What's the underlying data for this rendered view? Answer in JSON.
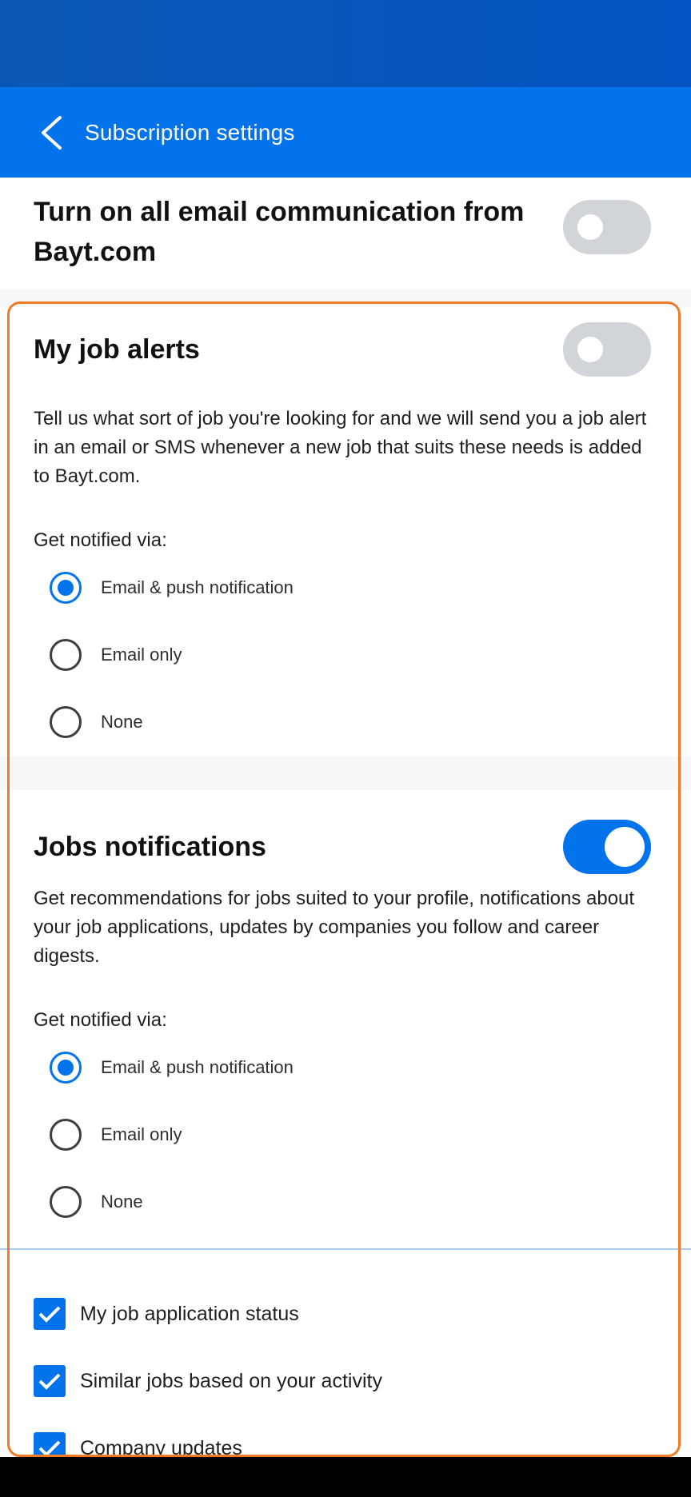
{
  "header": {
    "title": "Subscription settings"
  },
  "master": {
    "label": "Turn on all email communication from Bayt.com",
    "enabled": false
  },
  "job_alerts": {
    "title": "My job alerts",
    "enabled": false,
    "description": "Tell us what sort of job you're looking for and we will send you a job alert in an email or SMS whenever a new job that suits these needs is added to Bayt.com.",
    "notify_label": "Get notified via:",
    "options": [
      "Email & push notification",
      "Email only",
      "None"
    ],
    "selected": "Email & push notification"
  },
  "jobs_notifications": {
    "title": "Jobs notifications",
    "enabled": true,
    "description": "Get recommendations for jobs suited to your profile, notifications about your job applications, updates by companies you follow and career digests.",
    "notify_label": "Get notified via:",
    "options": [
      "Email & push notification",
      "Email only",
      "None"
    ],
    "selected": "Email & push notification",
    "checkboxes": [
      {
        "label": "My job application status",
        "checked": true
      },
      {
        "label": "Similar jobs based on your activity",
        "checked": true
      },
      {
        "label": "Company updates",
        "checked": true
      }
    ]
  },
  "colors": {
    "primary": "#0273ea",
    "status_bar": "#0354c2",
    "highlight": "#f07a26",
    "toggle_off": "#d1d4d8"
  }
}
